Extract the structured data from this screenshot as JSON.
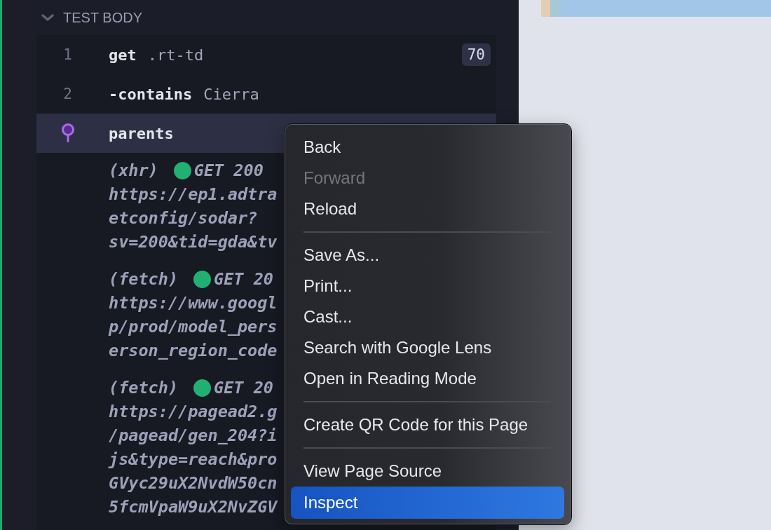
{
  "section": {
    "title": "TEST BODY",
    "expanded": true
  },
  "commands": [
    {
      "number": "1",
      "name": "get",
      "argument": ".rt-td",
      "badge": "70",
      "selected": false,
      "pinned": false
    },
    {
      "number": "2",
      "name": "-contains",
      "argument": "Cierra",
      "selected": false,
      "pinned": false
    },
    {
      "name": "parents",
      "selected": true,
      "pinned": true
    }
  ],
  "requests": [
    {
      "type": "(xhr)",
      "color": "#21b071",
      "status": "GET 200",
      "url_lines": [
        "https://ep1.adtra",
        "etconfig/sodar?",
        "sv=200&tid=gda&tv"
      ]
    },
    {
      "type": "(fetch)",
      "color": "#21b071",
      "status": "GET 20",
      "url_lines": [
        "https://www.googl",
        "p/prod/model_pers",
        "erson_region_code"
      ]
    },
    {
      "type": "(fetch)",
      "color": "#21b071",
      "status": "GET 20",
      "url_lines": [
        "https://pagead2.g",
        "/pagead/gen_204?i",
        "js&type=reach&pro",
        "GVyc29uX2NvdW50cn",
        "5fcmVpaW9uX2NvZGV"
      ]
    }
  ],
  "context_menu": [
    {
      "kind": "item",
      "label": "Back",
      "disabled": false,
      "selected": false
    },
    {
      "kind": "item",
      "label": "Forward",
      "disabled": true,
      "selected": false
    },
    {
      "kind": "item",
      "label": "Reload",
      "disabled": false,
      "selected": false
    },
    {
      "kind": "separator"
    },
    {
      "kind": "item",
      "label": "Save As...",
      "disabled": false,
      "selected": false
    },
    {
      "kind": "item",
      "label": "Print...",
      "disabled": false,
      "selected": false
    },
    {
      "kind": "item",
      "label": "Cast...",
      "disabled": false,
      "selected": false
    },
    {
      "kind": "item",
      "label": "Search with Google Lens",
      "disabled": false,
      "selected": false
    },
    {
      "kind": "item",
      "label": "Open in Reading Mode",
      "disabled": false,
      "selected": false
    },
    {
      "kind": "separator"
    },
    {
      "kind": "item",
      "label": "Create QR Code for this Page",
      "disabled": false,
      "selected": false
    },
    {
      "kind": "separator"
    },
    {
      "kind": "item",
      "label": "View Page Source",
      "disabled": false,
      "selected": false
    },
    {
      "kind": "item",
      "label": "Inspect",
      "disabled": false,
      "selected": true
    }
  ]
}
